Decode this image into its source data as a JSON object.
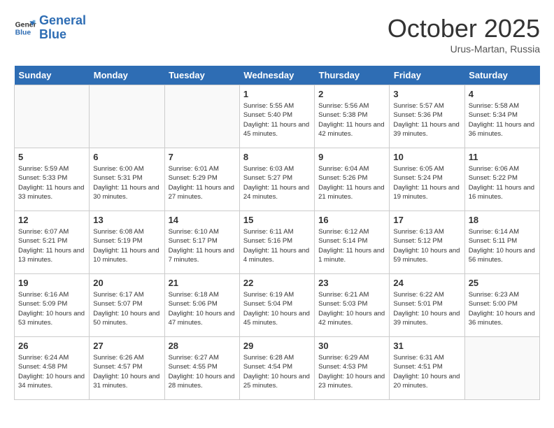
{
  "header": {
    "logo_line1": "General",
    "logo_line2": "Blue",
    "month": "October 2025",
    "location": "Urus-Martan, Russia"
  },
  "weekdays": [
    "Sunday",
    "Monday",
    "Tuesday",
    "Wednesday",
    "Thursday",
    "Friday",
    "Saturday"
  ],
  "weeks": [
    [
      {
        "day": "",
        "info": ""
      },
      {
        "day": "",
        "info": ""
      },
      {
        "day": "",
        "info": ""
      },
      {
        "day": "1",
        "info": "Sunrise: 5:55 AM\nSunset: 5:40 PM\nDaylight: 11 hours and 45 minutes."
      },
      {
        "day": "2",
        "info": "Sunrise: 5:56 AM\nSunset: 5:38 PM\nDaylight: 11 hours and 42 minutes."
      },
      {
        "day": "3",
        "info": "Sunrise: 5:57 AM\nSunset: 5:36 PM\nDaylight: 11 hours and 39 minutes."
      },
      {
        "day": "4",
        "info": "Sunrise: 5:58 AM\nSunset: 5:34 PM\nDaylight: 11 hours and 36 minutes."
      }
    ],
    [
      {
        "day": "5",
        "info": "Sunrise: 5:59 AM\nSunset: 5:33 PM\nDaylight: 11 hours and 33 minutes."
      },
      {
        "day": "6",
        "info": "Sunrise: 6:00 AM\nSunset: 5:31 PM\nDaylight: 11 hours and 30 minutes."
      },
      {
        "day": "7",
        "info": "Sunrise: 6:01 AM\nSunset: 5:29 PM\nDaylight: 11 hours and 27 minutes."
      },
      {
        "day": "8",
        "info": "Sunrise: 6:03 AM\nSunset: 5:27 PM\nDaylight: 11 hours and 24 minutes."
      },
      {
        "day": "9",
        "info": "Sunrise: 6:04 AM\nSunset: 5:26 PM\nDaylight: 11 hours and 21 minutes."
      },
      {
        "day": "10",
        "info": "Sunrise: 6:05 AM\nSunset: 5:24 PM\nDaylight: 11 hours and 19 minutes."
      },
      {
        "day": "11",
        "info": "Sunrise: 6:06 AM\nSunset: 5:22 PM\nDaylight: 11 hours and 16 minutes."
      }
    ],
    [
      {
        "day": "12",
        "info": "Sunrise: 6:07 AM\nSunset: 5:21 PM\nDaylight: 11 hours and 13 minutes."
      },
      {
        "day": "13",
        "info": "Sunrise: 6:08 AM\nSunset: 5:19 PM\nDaylight: 11 hours and 10 minutes."
      },
      {
        "day": "14",
        "info": "Sunrise: 6:10 AM\nSunset: 5:17 PM\nDaylight: 11 hours and 7 minutes."
      },
      {
        "day": "15",
        "info": "Sunrise: 6:11 AM\nSunset: 5:16 PM\nDaylight: 11 hours and 4 minutes."
      },
      {
        "day": "16",
        "info": "Sunrise: 6:12 AM\nSunset: 5:14 PM\nDaylight: 11 hours and 1 minute."
      },
      {
        "day": "17",
        "info": "Sunrise: 6:13 AM\nSunset: 5:12 PM\nDaylight: 10 hours and 59 minutes."
      },
      {
        "day": "18",
        "info": "Sunrise: 6:14 AM\nSunset: 5:11 PM\nDaylight: 10 hours and 56 minutes."
      }
    ],
    [
      {
        "day": "19",
        "info": "Sunrise: 6:16 AM\nSunset: 5:09 PM\nDaylight: 10 hours and 53 minutes."
      },
      {
        "day": "20",
        "info": "Sunrise: 6:17 AM\nSunset: 5:07 PM\nDaylight: 10 hours and 50 minutes."
      },
      {
        "day": "21",
        "info": "Sunrise: 6:18 AM\nSunset: 5:06 PM\nDaylight: 10 hours and 47 minutes."
      },
      {
        "day": "22",
        "info": "Sunrise: 6:19 AM\nSunset: 5:04 PM\nDaylight: 10 hours and 45 minutes."
      },
      {
        "day": "23",
        "info": "Sunrise: 6:21 AM\nSunset: 5:03 PM\nDaylight: 10 hours and 42 minutes."
      },
      {
        "day": "24",
        "info": "Sunrise: 6:22 AM\nSunset: 5:01 PM\nDaylight: 10 hours and 39 minutes."
      },
      {
        "day": "25",
        "info": "Sunrise: 6:23 AM\nSunset: 5:00 PM\nDaylight: 10 hours and 36 minutes."
      }
    ],
    [
      {
        "day": "26",
        "info": "Sunrise: 6:24 AM\nSunset: 4:58 PM\nDaylight: 10 hours and 34 minutes."
      },
      {
        "day": "27",
        "info": "Sunrise: 6:26 AM\nSunset: 4:57 PM\nDaylight: 10 hours and 31 minutes."
      },
      {
        "day": "28",
        "info": "Sunrise: 6:27 AM\nSunset: 4:55 PM\nDaylight: 10 hours and 28 minutes."
      },
      {
        "day": "29",
        "info": "Sunrise: 6:28 AM\nSunset: 4:54 PM\nDaylight: 10 hours and 25 minutes."
      },
      {
        "day": "30",
        "info": "Sunrise: 6:29 AM\nSunset: 4:53 PM\nDaylight: 10 hours and 23 minutes."
      },
      {
        "day": "31",
        "info": "Sunrise: 6:31 AM\nSunset: 4:51 PM\nDaylight: 10 hours and 20 minutes."
      },
      {
        "day": "",
        "info": ""
      }
    ]
  ]
}
